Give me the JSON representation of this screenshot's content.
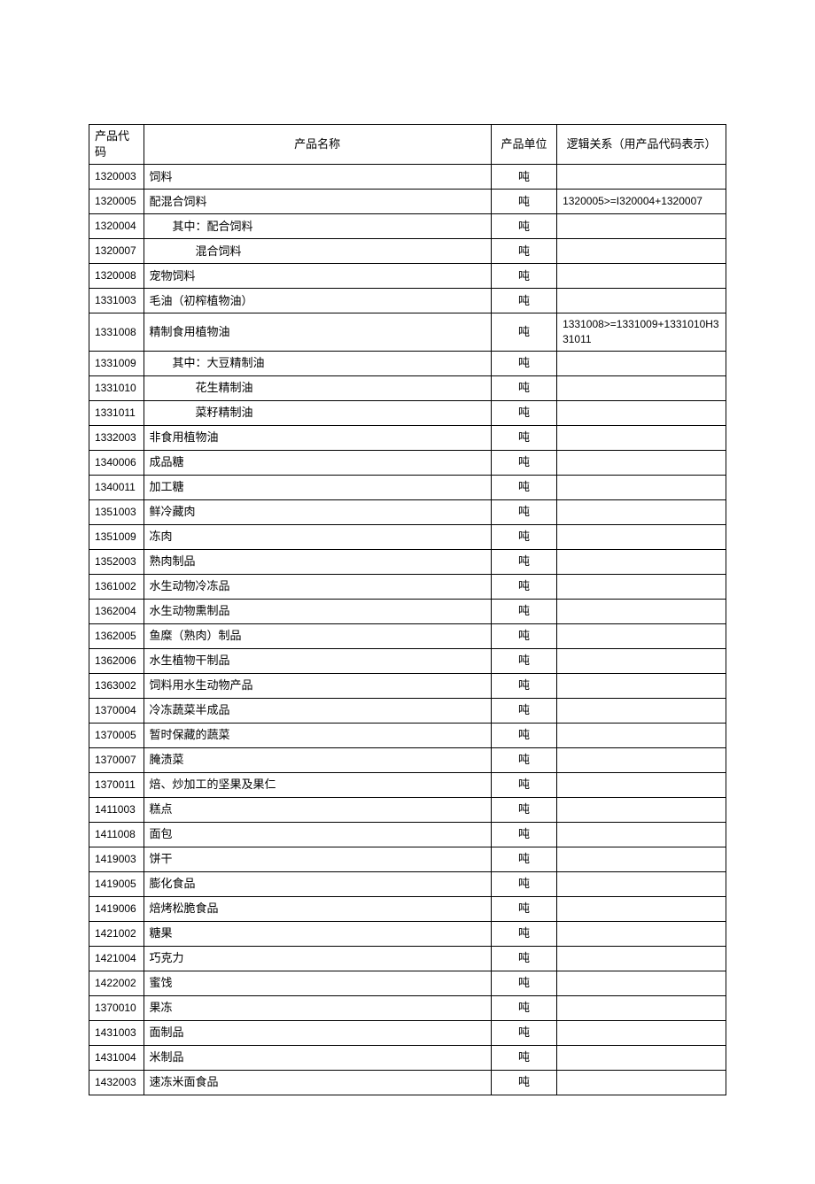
{
  "headers": {
    "code": "产品代码",
    "name": "产品名称",
    "unit": "产品单位",
    "logic": "逻辑关系（用产品代码表示）"
  },
  "rows": [
    {
      "code": "1320003",
      "name": "饲料",
      "unit": "吨",
      "logic": "",
      "indent": 0
    },
    {
      "code": "1320005",
      "name": "配混合饲料",
      "unit": "吨",
      "logic": "1320005>=I320004+1320007",
      "indent": 0
    },
    {
      "code": "1320004",
      "name": "其中：配合饲料",
      "unit": "吨",
      "logic": "",
      "indent": 1
    },
    {
      "code": "1320007",
      "name": "混合饲料",
      "unit": "吨",
      "logic": "",
      "indent": 2
    },
    {
      "code": "1320008",
      "name": "宠物饲料",
      "unit": "吨",
      "logic": "",
      "indent": 0
    },
    {
      "code": "1331003",
      "name": "毛油（初榨植物油）",
      "unit": "吨",
      "logic": "",
      "indent": 0
    },
    {
      "code": "1331008",
      "name": "精制食用植物油",
      "unit": "吨",
      "logic": "1331008>=1331009+1331010H331011",
      "indent": 0
    },
    {
      "code": "1331009",
      "name": "其中：大豆精制油",
      "unit": "吨",
      "logic": "",
      "indent": 1
    },
    {
      "code": "1331010",
      "name": "花生精制油",
      "unit": "吨",
      "logic": "",
      "indent": 2
    },
    {
      "code": "1331011",
      "name": "菜籽精制油",
      "unit": "吨",
      "logic": "",
      "indent": 2
    },
    {
      "code": "1332003",
      "name": "非食用植物油",
      "unit": "吨",
      "logic": "",
      "indent": 0
    },
    {
      "code": "1340006",
      "name": "成品糖",
      "unit": "吨",
      "logic": "",
      "indent": 0
    },
    {
      "code": "1340011",
      "name": "加工糖",
      "unit": "吨",
      "logic": "",
      "indent": 0
    },
    {
      "code": "1351003",
      "name": "鲜冷藏肉",
      "unit": "吨",
      "logic": "",
      "indent": 0
    },
    {
      "code": "1351009",
      "name": "冻肉",
      "unit": "吨",
      "logic": "",
      "indent": 0
    },
    {
      "code": "1352003",
      "name": "熟肉制品",
      "unit": "吨",
      "logic": "",
      "indent": 0
    },
    {
      "code": "1361002",
      "name": "水生动物冷冻品",
      "unit": "吨",
      "logic": "",
      "indent": 0
    },
    {
      "code": "1362004",
      "name": "水生动物熏制品",
      "unit": "吨",
      "logic": "",
      "indent": 0
    },
    {
      "code": "1362005",
      "name": "鱼糜（熟肉）制品",
      "unit": "吨",
      "logic": "",
      "indent": 0
    },
    {
      "code": "1362006",
      "name": "水生植物干制品",
      "unit": "吨",
      "logic": "",
      "indent": 0
    },
    {
      "code": "1363002",
      "name": "饲料用水生动物产品",
      "unit": "吨",
      "logic": "",
      "indent": 0
    },
    {
      "code": "1370004",
      "name": "冷冻蔬菜半成品",
      "unit": "吨",
      "logic": "",
      "indent": 0
    },
    {
      "code": "1370005",
      "name": "暂时保藏的蔬菜",
      "unit": "吨",
      "logic": "",
      "indent": 0
    },
    {
      "code": "1370007",
      "name": "腌渍菜",
      "unit": "吨",
      "logic": "",
      "indent": 0
    },
    {
      "code": "1370011",
      "name": "焙、炒加工的坚果及果仁",
      "unit": "吨",
      "logic": "",
      "indent": 0
    },
    {
      "code": "1411003",
      "name": "糕点",
      "unit": "吨",
      "logic": "",
      "indent": 0
    },
    {
      "code": "1411008",
      "name": "面包",
      "unit": "吨",
      "logic": "",
      "indent": 0
    },
    {
      "code": "1419003",
      "name": "饼干",
      "unit": "吨",
      "logic": "",
      "indent": 0
    },
    {
      "code": "1419005",
      "name": "膨化食品",
      "unit": "吨",
      "logic": "",
      "indent": 0
    },
    {
      "code": "1419006",
      "name": "焙烤松脆食品",
      "unit": "吨",
      "logic": "",
      "indent": 0
    },
    {
      "code": "1421002",
      "name": "糖果",
      "unit": "吨",
      "logic": "",
      "indent": 0
    },
    {
      "code": "1421004",
      "name": "巧克力",
      "unit": "吨",
      "logic": "",
      "indent": 0
    },
    {
      "code": "1422002",
      "name": "蜜饯",
      "unit": "吨",
      "logic": "",
      "indent": 0
    },
    {
      "code": "1370010",
      "name": "果冻",
      "unit": "吨",
      "logic": "",
      "indent": 0
    },
    {
      "code": "1431003",
      "name": "面制品",
      "unit": "吨",
      "logic": "",
      "indent": 0
    },
    {
      "code": "1431004",
      "name": "米制品",
      "unit": "吨",
      "logic": "",
      "indent": 0
    },
    {
      "code": "1432003",
      "name": "速冻米面食品",
      "unit": "吨",
      "logic": "",
      "indent": 0
    }
  ]
}
